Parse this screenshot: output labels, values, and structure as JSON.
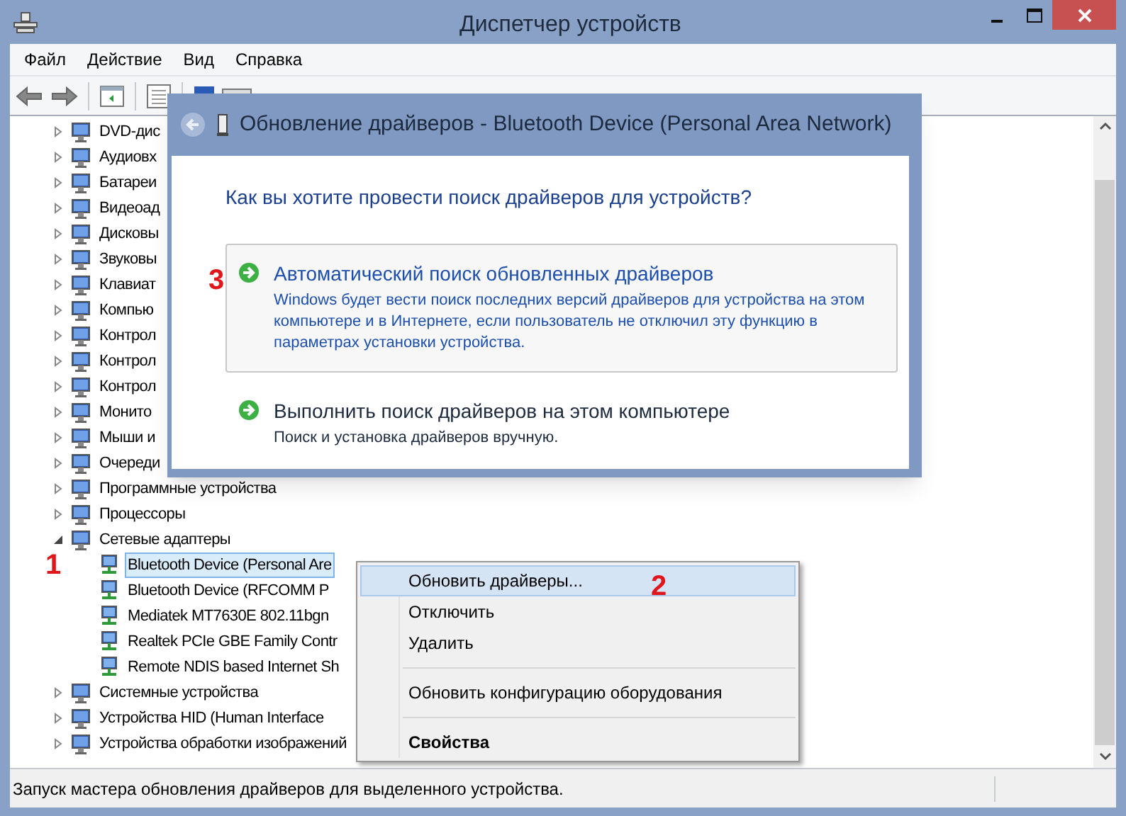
{
  "window": {
    "title": "Диспетчер устройств"
  },
  "menu": [
    "Файл",
    "Действие",
    "Вид",
    "Справка"
  ],
  "tree": [
    {
      "label": "DVD-дис",
      "expanded": false,
      "selected": false
    },
    {
      "label": "Аудиовх",
      "expanded": false,
      "selected": false
    },
    {
      "label": "Батареи",
      "expanded": false,
      "selected": false
    },
    {
      "label": "Видеоад",
      "expanded": false,
      "selected": false
    },
    {
      "label": "Дисковы",
      "expanded": false,
      "selected": false
    },
    {
      "label": "Звуковы",
      "expanded": false,
      "selected": false
    },
    {
      "label": "Клавиат",
      "expanded": false,
      "selected": false
    },
    {
      "label": "Компью",
      "expanded": false,
      "selected": false
    },
    {
      "label": "Контрол",
      "expanded": false,
      "selected": false
    },
    {
      "label": "Контрол",
      "expanded": false,
      "selected": false
    },
    {
      "label": "Контрол",
      "expanded": false,
      "selected": false
    },
    {
      "label": "Монито",
      "expanded": false,
      "selected": false
    },
    {
      "label": "Мыши и",
      "expanded": false,
      "selected": false
    },
    {
      "label": "Очереди",
      "expanded": false,
      "selected": false
    },
    {
      "label": "Программные устройства",
      "expanded": false,
      "selected": false
    },
    {
      "label": "Процессоры",
      "expanded": false,
      "selected": false
    },
    {
      "label": "Сетевые адаптеры",
      "expanded": true,
      "selected": false,
      "children": [
        {
          "label": "Bluetooth Device (Personal Are",
          "selected": true,
          "annotation": "1"
        },
        {
          "label": "Bluetooth Device (RFCOMM P",
          "selected": false
        },
        {
          "label": "Mediatek MT7630E 802.11bgn",
          "selected": false
        },
        {
          "label": "Realtek PCIe GBE Family Contr",
          "selected": false
        },
        {
          "label": "Remote NDIS based Internet Sh",
          "selected": false
        }
      ]
    },
    {
      "label": "Системные устройства",
      "expanded": false,
      "selected": false
    },
    {
      "label": "Устройства HID (Human Interface",
      "expanded": false,
      "selected": false
    },
    {
      "label": "Устройства обработки изображений",
      "expanded": false,
      "selected": false
    }
  ],
  "status_bar": "Запуск мастера обновления драйверов для выделенного устройства.",
  "dialog": {
    "title": "Обновление драйверов - Bluetooth Device (Personal Area Network)",
    "question": "Как вы хотите провести поиск драйверов для устройств?",
    "options": [
      {
        "title": "Автоматический поиск обновленных драйверов",
        "description": "Windows будет вести поиск последних версий драйверов для устройства на этом компьютере и в Интернете, если пользователь не отключил эту функцию в параметрах установки устройства.",
        "highlighted": true,
        "annotation": "3"
      },
      {
        "title": "Выполнить поиск драйверов на этом компьютере",
        "description": "Поиск и установка драйверов вручную.",
        "highlighted": false
      }
    ]
  },
  "context_menu": [
    {
      "kind": "item",
      "label": "Обновить драйверы...",
      "selected": true,
      "bold": false,
      "annotation": "2"
    },
    {
      "kind": "item",
      "label": "Отключить",
      "selected": false,
      "bold": false
    },
    {
      "kind": "item",
      "label": "Удалить",
      "selected": false,
      "bold": false
    },
    {
      "kind": "separator"
    },
    {
      "kind": "item",
      "label": "Обновить конфигурацию оборудования",
      "selected": false,
      "bold": false
    },
    {
      "kind": "separator"
    },
    {
      "kind": "item",
      "label": "Свойства",
      "selected": false,
      "bold": true
    }
  ]
}
